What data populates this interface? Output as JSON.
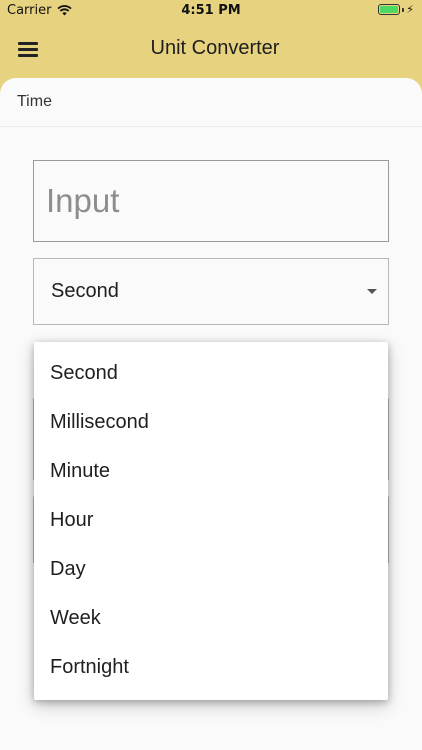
{
  "status_bar": {
    "carrier": "Carrier",
    "time": "4:51 PM",
    "icons": {
      "wifi": "wifi-icon",
      "battery": "battery-icon",
      "charging": "charging-bolt-icon"
    }
  },
  "header": {
    "menu_icon": "hamburger-menu-icon",
    "title": "Unit Converter",
    "background_color": "#e7d37f"
  },
  "section": {
    "title": "Time"
  },
  "input": {
    "placeholder": "Input",
    "value": ""
  },
  "from_unit": {
    "selected": "Second"
  },
  "dropdown": {
    "options": [
      "Second",
      "Millisecond",
      "Minute",
      "Hour",
      "Day",
      "Week",
      "Fortnight"
    ]
  }
}
